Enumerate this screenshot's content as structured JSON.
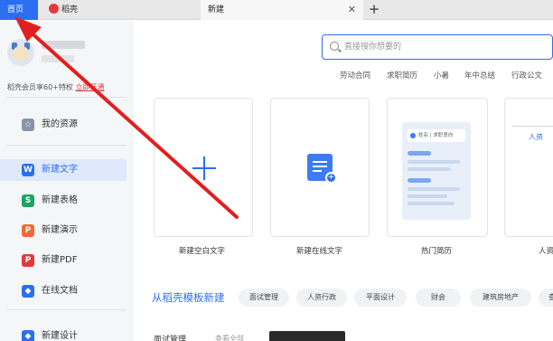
{
  "tabs": {
    "home": "首页",
    "daoke": "稻壳",
    "new": "新建",
    "close_symbol": "✕",
    "add_symbol": "+"
  },
  "user": {
    "vip_text": "稻壳会员享60+特权",
    "vip_link": "立即开通"
  },
  "sidebar": {
    "items": [
      {
        "label": "我的资源",
        "icon": "star-icon",
        "color": "#8a94a6",
        "glyph": "☆"
      },
      {
        "label": "新建文字",
        "icon": "writer-icon",
        "color": "#2b6ef2",
        "glyph": "W",
        "active": true
      },
      {
        "label": "新建表格",
        "icon": "sheet-icon",
        "color": "#1ea362",
        "glyph": "S"
      },
      {
        "label": "新建演示",
        "icon": "slides-icon",
        "color": "#f06a35",
        "glyph": "P"
      },
      {
        "label": "新建PDF",
        "icon": "pdf-icon",
        "color": "#e4393c",
        "glyph": "P"
      },
      {
        "label": "在线文档",
        "icon": "cloud-doc-icon",
        "color": "#2b6ef2",
        "glyph": "◆"
      },
      {
        "label": "新建设计",
        "icon": "design-icon",
        "color": "#2b6ef2",
        "glyph": "◆"
      }
    ]
  },
  "search": {
    "placeholder": "直接搜你想要的"
  },
  "quick_tags": [
    "劳动合同",
    "求职简历",
    "小暑",
    "年中总结",
    "行政公文"
  ],
  "cards": [
    {
      "label": "新建空白文字"
    },
    {
      "label": "新建在线文字"
    },
    {
      "label": "热门简历",
      "preview_name": "姓名 | 求职意向"
    },
    {
      "label": "人资",
      "preview_title": "人资"
    }
  ],
  "templates": {
    "title": "从稻壳模板新建",
    "chips": [
      "面试管理",
      "人资行政",
      "平面设计",
      "财会",
      "建筑房地产",
      "查"
    ]
  },
  "bottom": {
    "text": "面试管理",
    "more": "查看全部"
  },
  "colors": {
    "accent": "#2b6ef2",
    "arrow": "#e02020"
  }
}
